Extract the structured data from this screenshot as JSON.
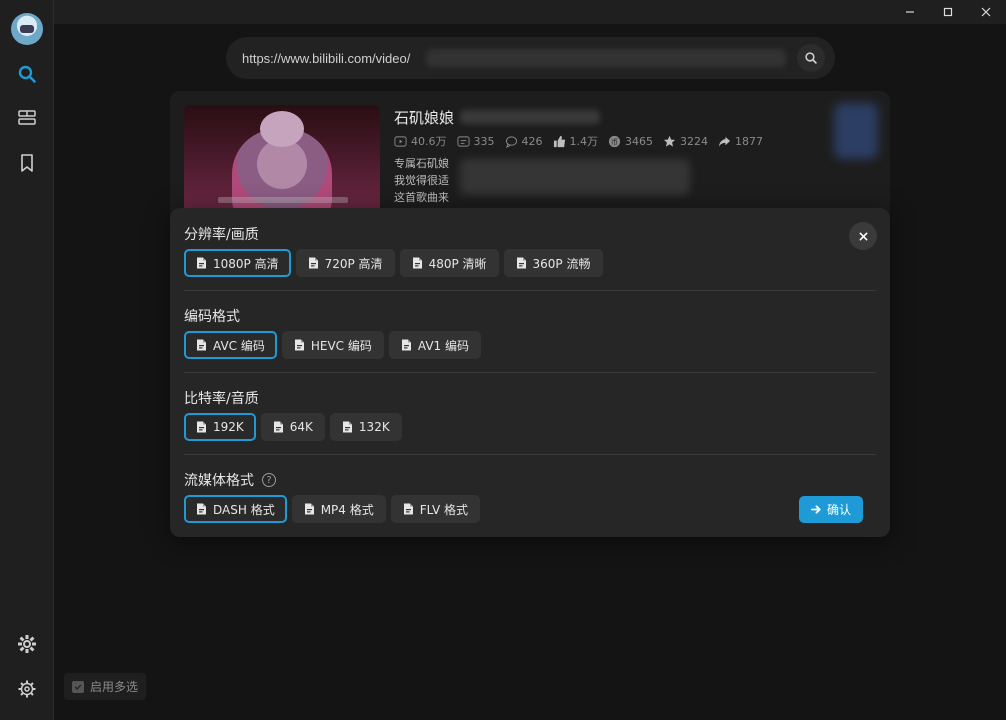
{
  "window": {
    "minimize": "minimize",
    "maximize": "maximize",
    "close": "close"
  },
  "search": {
    "value": "https://www.bilibili.com/video/"
  },
  "video": {
    "title": "石矶娘娘",
    "stats": {
      "views": "40.6万",
      "danmaku": "335",
      "comments": "426",
      "likes": "1.4万",
      "coins": "3465",
      "favorites": "3224",
      "shares": "1877"
    },
    "desc_lines": [
      "专属石矶娘",
      "我觉得很适",
      "这首歌曲来"
    ]
  },
  "modal": {
    "sections": [
      {
        "title": "分辨率/画质",
        "options": [
          "1080P 高清",
          "720P 高清",
          "480P 清晰",
          "360P 流畅"
        ],
        "selected": 0
      },
      {
        "title": "编码格式",
        "options": [
          "AVC 编码",
          "HEVC 编码",
          "AV1 编码"
        ],
        "selected": 0
      },
      {
        "title": "比特率/音质",
        "options": [
          "192K",
          "64K",
          "132K"
        ],
        "selected": 0
      },
      {
        "title": "流媒体格式",
        "help": "?",
        "options": [
          "DASH 格式",
          "MP4 格式",
          "FLV 格式"
        ],
        "selected": 0
      }
    ],
    "confirm": "确认"
  },
  "multi_select": "启用多选",
  "colors": {
    "accent": "#1e9ad6",
    "bg": "#141414",
    "panel": "#262626"
  }
}
